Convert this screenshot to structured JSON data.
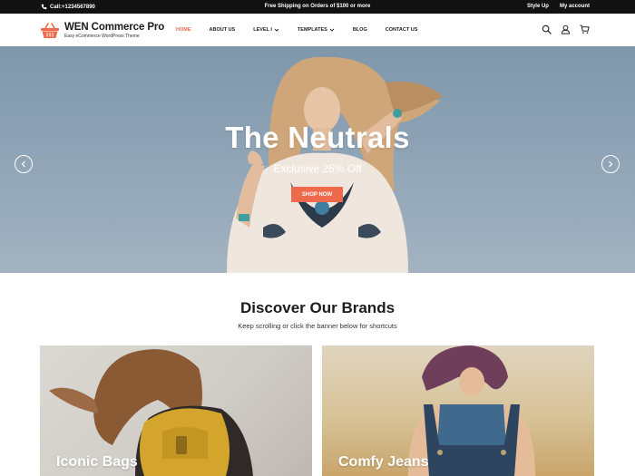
{
  "topbar": {
    "phone": "Call:+1234567890",
    "promo": "Free Shipping on Orders of $100 or more",
    "style_up": "Style Up",
    "my_account": "My account"
  },
  "header": {
    "site_name": "WEN Commerce Pro",
    "tagline": "Easy eCommerce WordPress Theme",
    "nav": [
      "HOME",
      "ABOUT US",
      "LEVEL I",
      "TEMPLATES",
      "BLOG",
      "CONTACT US"
    ]
  },
  "hero": {
    "title": "The Neutrals",
    "subtitle": "Exclusive 25% Off",
    "button": "SHOP NOW"
  },
  "brands": {
    "title": "Discover Our Brands",
    "subtitle": "Keep scrolling or click the banner below for shortcuts",
    "cards": [
      "Iconic Bags",
      "Comfy Jeans"
    ]
  },
  "colors": {
    "accent": "#ef6a4c",
    "topbar_bg": "#111111",
    "text": "#1c1c1c"
  },
  "icons": {
    "phone": "phone-icon",
    "search": "search-icon",
    "user": "user-icon",
    "cart": "cart-icon",
    "logo": "basket-logo-icon",
    "prev": "chevron-left-icon",
    "next": "chevron-right-icon"
  }
}
